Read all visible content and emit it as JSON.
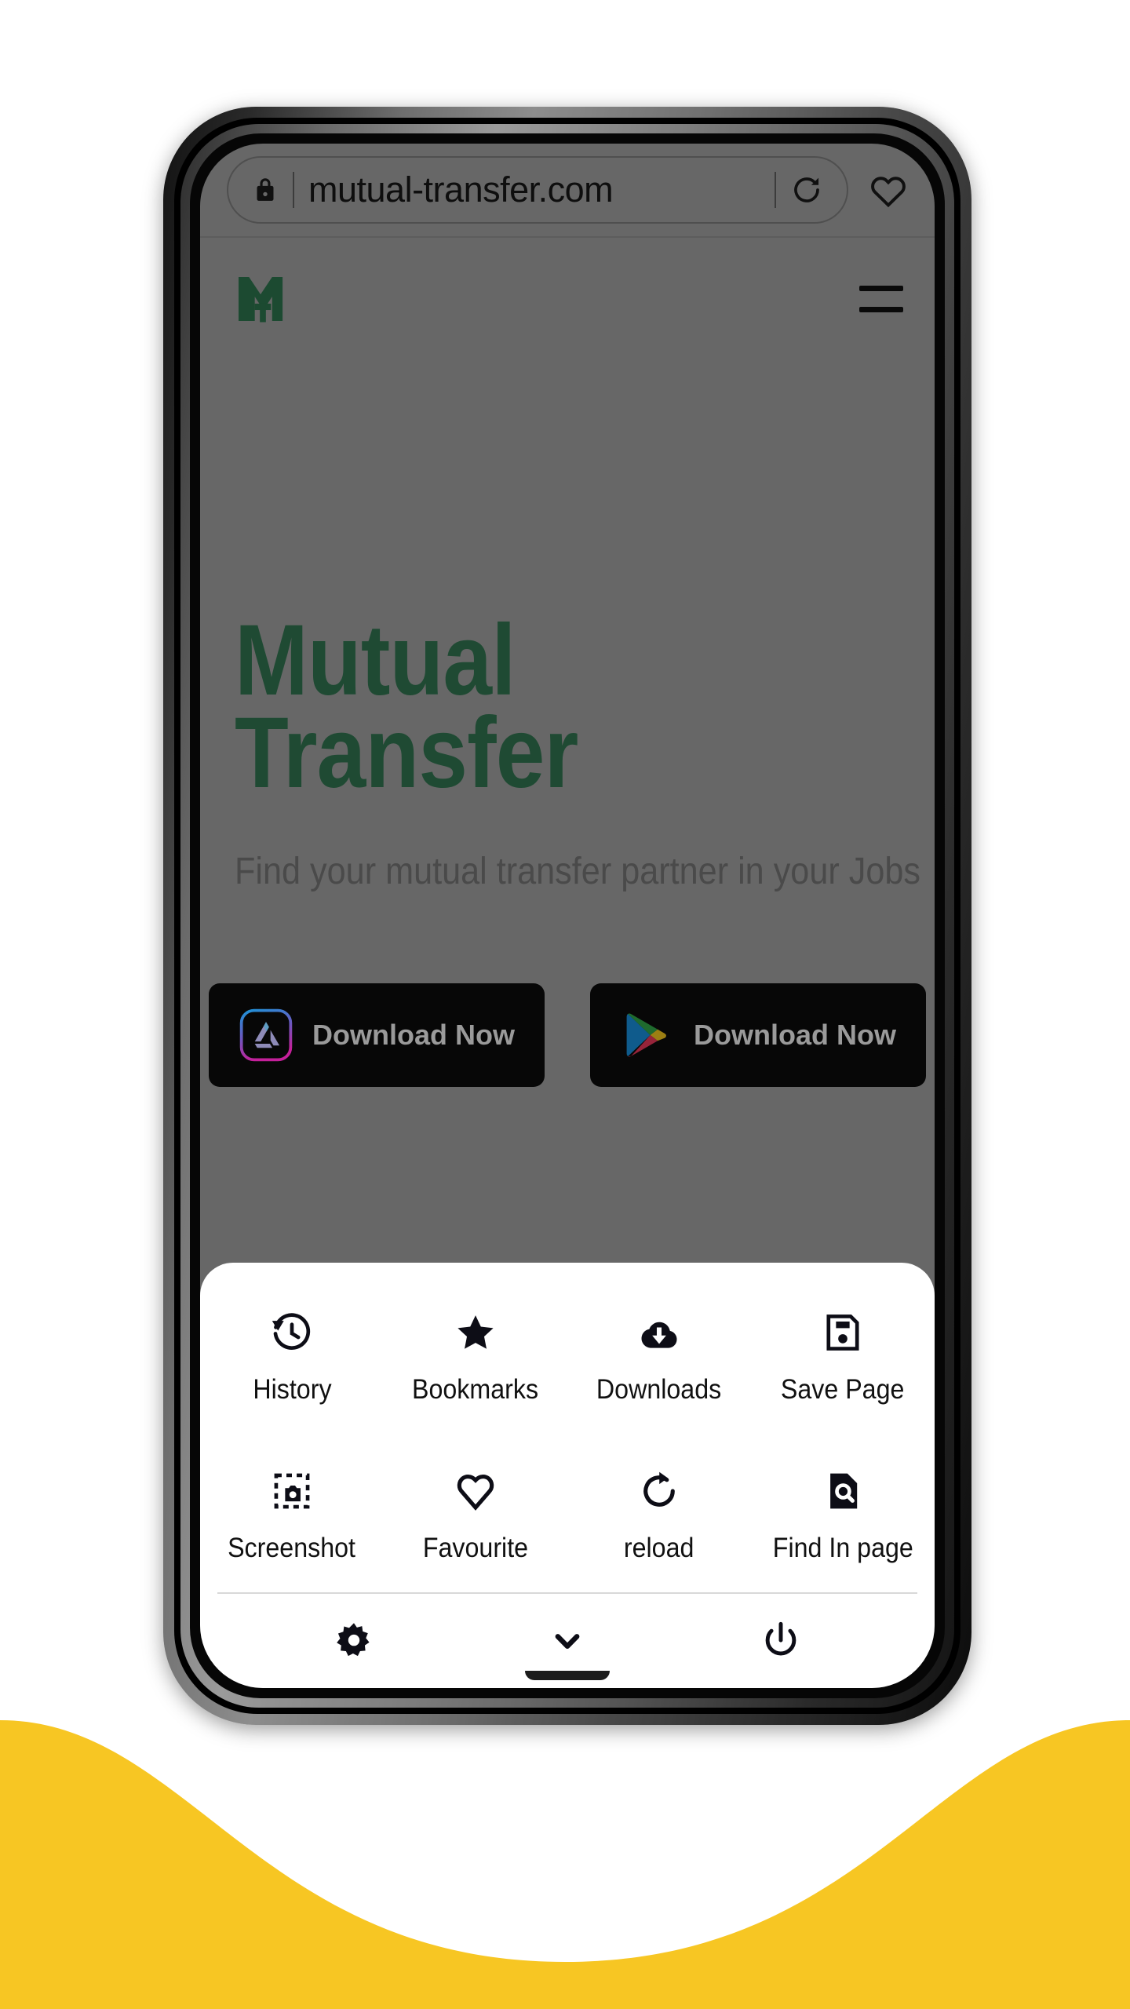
{
  "canvas": {
    "background": "#ffffff",
    "accent_yellow": "#f7c623"
  },
  "browser": {
    "address_bar": {
      "lock_icon": "lock-icon",
      "url": "mutual-transfer.com",
      "reload_icon": "reload-icon"
    },
    "favourite_icon": "heart-icon"
  },
  "site": {
    "logo_icon": "mutual-transfer-logo-icon",
    "menu_icon": "hamburger-menu-icon",
    "hero": {
      "title_line1": "Mutual",
      "title_line2": "Transfer",
      "subtitle": "Find your mutual transfer partner in your Jobs",
      "title_color": "#1f4a33"
    },
    "store_buttons": [
      {
        "icon": "app-store-icon",
        "label": "Download Now"
      },
      {
        "icon": "google-play-icon",
        "label": "Download Now"
      }
    ]
  },
  "menu_sheet": {
    "items": [
      {
        "icon": "history-icon",
        "label": "History"
      },
      {
        "icon": "bookmarks-star-icon",
        "label": "Bookmarks"
      },
      {
        "icon": "downloads-icon",
        "label": "Downloads"
      },
      {
        "icon": "save-page-icon",
        "label": "Save Page"
      },
      {
        "icon": "screenshot-icon",
        "label": "Screenshot"
      },
      {
        "icon": "favourite-heart-icon",
        "label": "Favourite"
      },
      {
        "icon": "reload-icon",
        "label": "reload"
      },
      {
        "icon": "find-in-page-icon",
        "label": "Find In page"
      }
    ],
    "footer": [
      {
        "icon": "settings-gear-icon"
      },
      {
        "icon": "chevron-down-icon"
      },
      {
        "icon": "power-icon"
      }
    ]
  }
}
